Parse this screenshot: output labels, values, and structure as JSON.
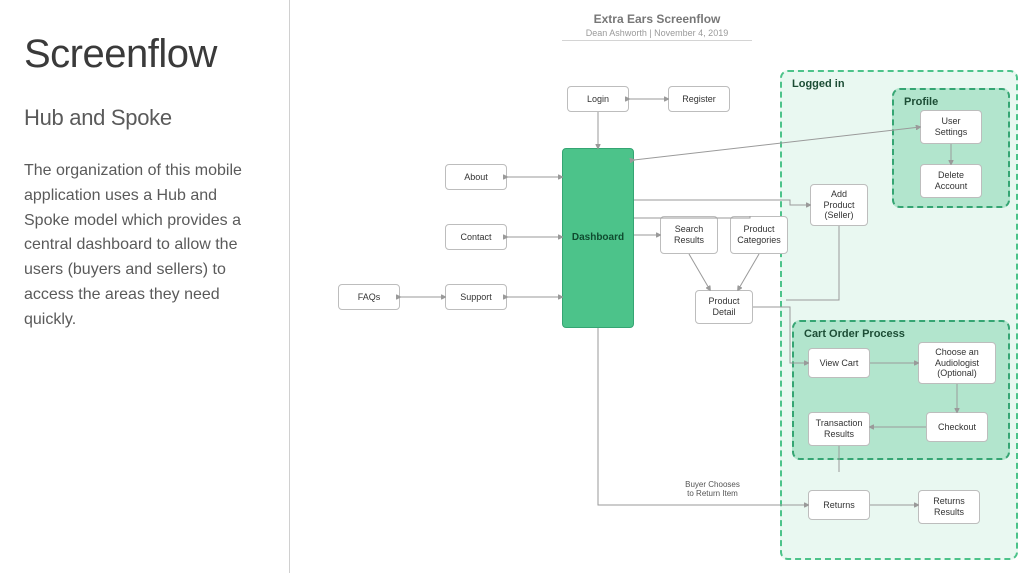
{
  "left": {
    "title": "Screenflow",
    "subtitle": "Hub and Spoke",
    "body": "The organization of this mobile application uses a Hub and Spoke model which provides a central dashboard to allow the users (buyers and sellers) to access the areas they need quickly."
  },
  "diagram": {
    "title": "Extra Ears Screenflow",
    "subtitle": "Dean Ashworth | November 4, 2019",
    "hub": "Dashboard",
    "nodes": {
      "login": "Login",
      "register": "Register",
      "about": "About",
      "contact": "Contact",
      "support": "Support",
      "faqs": "FAQs",
      "search_results": "Search Results",
      "product_categories": "Product Categories",
      "product_detail": "Product Detail",
      "add_product_seller": "Add Product (Seller)",
      "user_settings": "User Settings",
      "delete_account": "Delete Account",
      "view_cart": "View Cart",
      "choose_audiologist": "Choose an Audiologist (Optional)",
      "checkout": "Checkout",
      "transaction_results": "Transaction Results",
      "returns": "Returns",
      "returns_results": "Returns Results"
    },
    "groups": {
      "logged_in": "Logged in",
      "profile": "Profile",
      "cart_order_process": "Cart Order Process"
    },
    "edge_labels": {
      "buyer_chooses_return": "Buyer Chooses to Return Item"
    }
  }
}
